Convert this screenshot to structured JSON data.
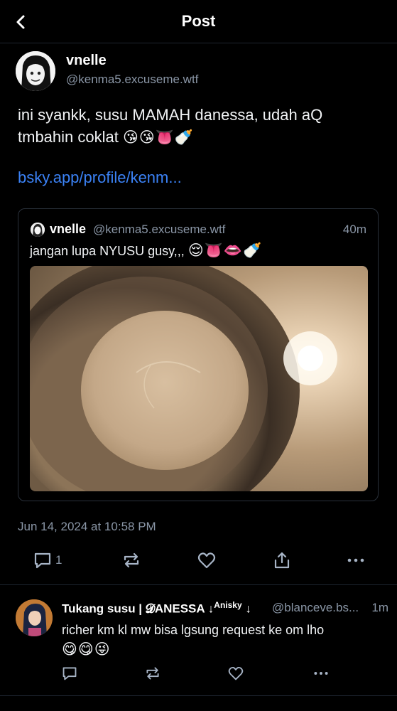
{
  "header": {
    "title": "Post"
  },
  "post": {
    "author_name": "vnelle",
    "author_handle": "@kenma5.excuseme.wtf",
    "text_line1": "ini syankk, susu MAMAH danessa, udah aQ",
    "text_line2": "tmbahin coklat",
    "text_emojis": "😘😘👅🍼",
    "link": "bsky.app/profile/kenm...",
    "timestamp": "Jun 14, 2024 at 10:58 PM",
    "reply_count": "1"
  },
  "quote": {
    "author_name": "vnelle",
    "author_handle": "@kenma5.excuseme.wtf",
    "time": "40m",
    "text": "jangan lupa NYUSU gusy,,,",
    "text_emojis": "😌👅👄🍼"
  },
  "reply": {
    "author_name": "Tukang susu | 𝓓ANESSA ↓",
    "author_sup": "Anisky",
    "author_tail": "↓",
    "author_handle": "@blanceve.bs...",
    "time": "1m",
    "text": "richer km kl mw bisa lgsung request ke om lho",
    "text_emojis": "😋😋😜"
  },
  "colors": {
    "background": "#000000",
    "link": "#3b82f6",
    "muted": "#8a96a6",
    "divider": "#1e2530"
  },
  "icons": [
    "back-chevron-icon",
    "reply-icon",
    "repost-icon",
    "like-icon",
    "share-icon",
    "more-icon"
  ]
}
